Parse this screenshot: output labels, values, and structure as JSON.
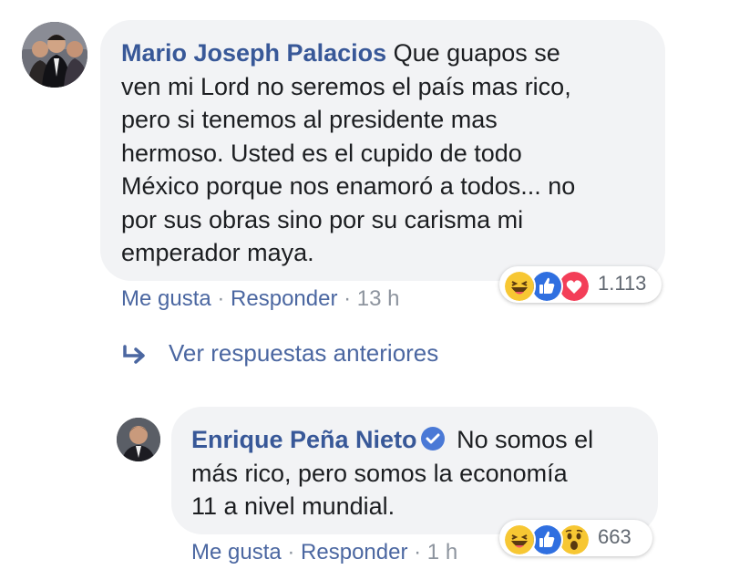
{
  "comment": {
    "author": "Mario Joseph Palacios",
    "text_lines": [
      " Que guapos se",
      "ven mi Lord no seremos el país mas rico,",
      "pero si tenemos al presidente mas",
      "hermoso. Usted es el cupido de todo",
      "México porque nos enamoró a todos... no",
      "por sus obras sino por su carisma mi",
      "emperador maya."
    ],
    "reactions": {
      "icons": [
        "haha-icon",
        "like-icon",
        "love-icon"
      ],
      "count": "1.113"
    },
    "actions": {
      "like": "Me gusta",
      "separator": " · ",
      "reply": "Responder",
      "time": "13 h"
    }
  },
  "view_previous_replies": "Ver respuestas anteriores",
  "reply": {
    "author": "Enrique Peña Nieto",
    "text_lines": [
      " No somos el",
      "más rico, pero somos la economía",
      "11 a nivel mundial."
    ],
    "reactions": {
      "icons": [
        "haha-icon",
        "like-icon",
        "wow-icon"
      ],
      "count": "663"
    },
    "actions": {
      "like": "Me gusta",
      "separator": " · ",
      "reply": "Responder",
      "time": "1 h"
    }
  },
  "colors": {
    "author_link": "#385898",
    "action_link": "#4b67a1",
    "bubble_bg": "#f2f3f5",
    "muted": "#8d949e",
    "like_blue": "#2f6fe0",
    "love_red": "#f33e58",
    "haha_yellow": "#f7c733"
  }
}
